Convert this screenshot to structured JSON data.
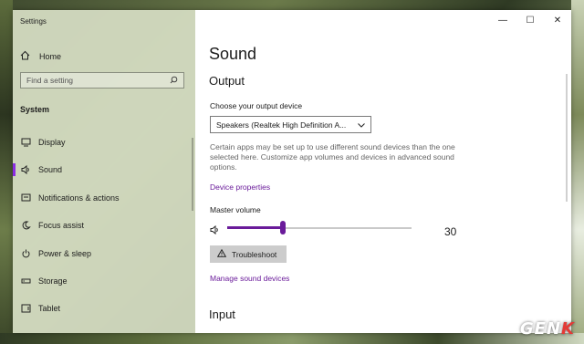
{
  "app_title": "Settings",
  "sidebar": {
    "home_label": "Home",
    "search_placeholder": "Find a setting",
    "section": "System",
    "items": [
      {
        "label": "Display",
        "icon": "display-icon"
      },
      {
        "label": "Sound",
        "icon": "speaker-icon",
        "active": true
      },
      {
        "label": "Notifications & actions",
        "icon": "notifications-icon"
      },
      {
        "label": "Focus assist",
        "icon": "moon-icon"
      },
      {
        "label": "Power & sleep",
        "icon": "power-icon"
      },
      {
        "label": "Storage",
        "icon": "storage-icon"
      },
      {
        "label": "Tablet",
        "icon": "tablet-icon"
      }
    ]
  },
  "window_controls": {
    "minimize": "—",
    "maximize": "☐",
    "close": "✕"
  },
  "main": {
    "title": "Sound",
    "output_header": "Output",
    "choose_label": "Choose your output device",
    "device_value": "Speakers (Realtek High Definition A...",
    "description": "Certain apps may be set up to use different sound devices than the one selected here. Customize app volumes and devices in advanced sound options.",
    "device_properties_link": "Device properties",
    "master_volume_label": "Master volume",
    "volume": 30,
    "troubleshoot_label": "Troubleshoot",
    "manage_devices_link": "Manage sound devices",
    "input_header": "Input"
  },
  "accent_color": "#6a1b9a",
  "watermark": {
    "pre": "GEN",
    "o": "K"
  }
}
